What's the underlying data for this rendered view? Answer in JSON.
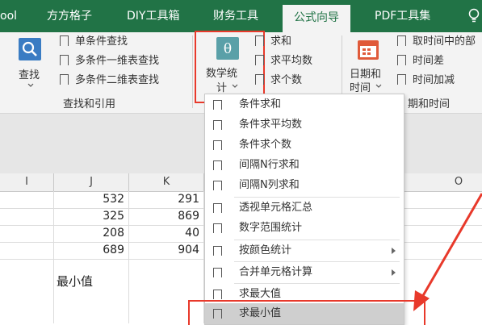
{
  "tabs": [
    {
      "label": "ool"
    },
    {
      "label": "方方格子"
    },
    {
      "label": "DIY工具箱"
    },
    {
      "label": "财务工具"
    },
    {
      "label": "公式向导"
    },
    {
      "label": "PDF工具集"
    }
  ],
  "ribbon": {
    "lookup": {
      "big_label": "查找",
      "items": [
        "单条件查找",
        "多条件一维表查找",
        "多条件二维表查找"
      ],
      "group_label": "查找和引用"
    },
    "math": {
      "big_label_1": "数学统",
      "big_label_2": "计",
      "items": [
        "求和",
        "求平均数",
        "求个数"
      ]
    },
    "date": {
      "big_label_1": "日期和",
      "big_label_2": "时间",
      "items": [
        "取时间中的部",
        "时间差",
        "时间加减"
      ],
      "group_label": "期和时间"
    }
  },
  "sheet": {
    "columns": [
      "I",
      "J",
      "K",
      "O"
    ],
    "rows": [
      [
        "532",
        "291"
      ],
      [
        "325",
        "869"
      ],
      [
        "208",
        "40"
      ],
      [
        "689",
        "904"
      ]
    ],
    "label_cell": "最小值"
  },
  "dropdown": {
    "items": [
      {
        "label": "条件求和",
        "submenu": false
      },
      {
        "label": "条件求平均数",
        "submenu": false
      },
      {
        "label": "条件求个数",
        "submenu": false
      },
      {
        "label": "间隔N行求和",
        "submenu": false
      },
      {
        "label": "间隔N列求和",
        "submenu": false
      },
      {
        "label": "透视单元格汇总",
        "submenu": false
      },
      {
        "label": "数字范围统计",
        "submenu": false
      },
      {
        "label": "按颜色统计",
        "submenu": true
      },
      {
        "label": "合并单元格计算",
        "submenu": true
      },
      {
        "label": "求最大值",
        "submenu": false
      },
      {
        "label": "求最小值",
        "submenu": false
      }
    ],
    "selected": "求最小值"
  },
  "colors": {
    "tab_bar": "#217346",
    "highlight_red": "#e8392b",
    "selected_item": "#cfcfcf"
  },
  "icons": [
    "search-icon",
    "theta-icon",
    "calendar-icon",
    "lightbulb-icon",
    "bookmark-icon",
    "chevron-down-icon",
    "submenu-arrow-icon",
    "red-arrow-annotation"
  ]
}
